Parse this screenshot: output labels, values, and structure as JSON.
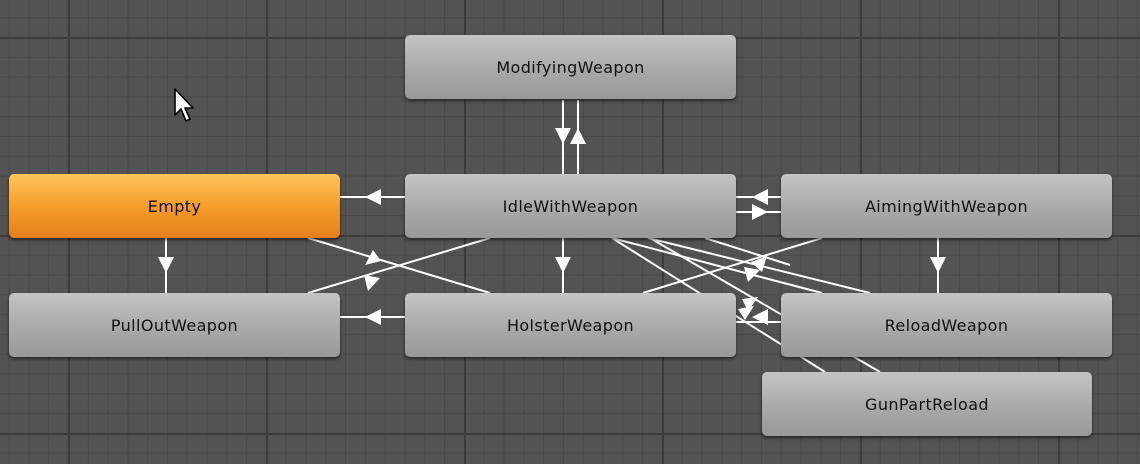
{
  "graph": {
    "states": {
      "modifying": "ModifyingWeapon",
      "empty": "Empty",
      "idle": "IdleWithWeapon",
      "aiming": "AimingWithWeapon",
      "pullout": "PullOutWeapon",
      "holster": "HolsterWeapon",
      "reload": "ReloadWeapon",
      "gunpart": "GunPartReload"
    },
    "default_state": "empty"
  },
  "colors": {
    "canvas": "#535353",
    "node": "#a9a9a9",
    "active_node": "#f39a27",
    "transition": "#ffffff",
    "label": "#111111"
  }
}
